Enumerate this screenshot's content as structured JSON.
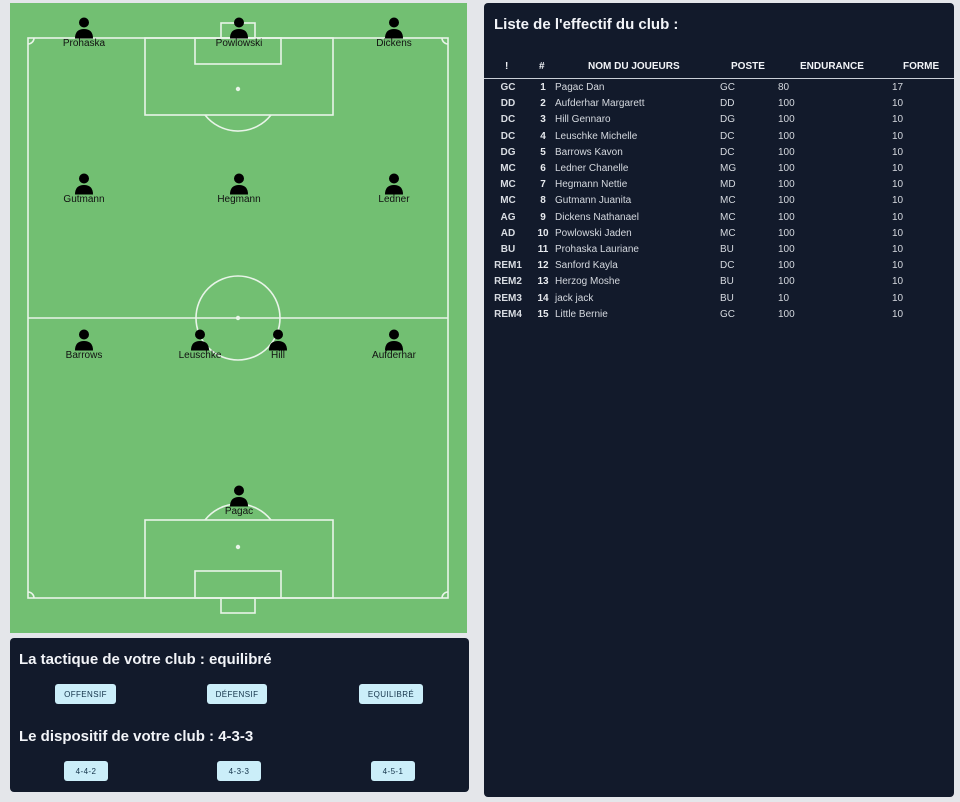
{
  "pitch": {
    "players": [
      {
        "name": "Prohaska",
        "role": "striker-left"
      },
      {
        "name": "Powlowski",
        "role": "striker-center"
      },
      {
        "name": "Dickens",
        "role": "striker-right"
      },
      {
        "name": "Gutmann",
        "role": "midfield-left"
      },
      {
        "name": "Hegmann",
        "role": "midfield-center"
      },
      {
        "name": "Ledner",
        "role": "midfield-right"
      },
      {
        "name": "Barrows",
        "role": "defender-1"
      },
      {
        "name": "Leuschke",
        "role": "defender-2"
      },
      {
        "name": "Hill",
        "role": "defender-3"
      },
      {
        "name": "Aufderhar",
        "role": "defender-4"
      },
      {
        "name": "Pagac",
        "role": "goalkeeper"
      }
    ],
    "player_icon": "person-icon"
  },
  "tactics": {
    "title": "La tactique de votre club : equilibré",
    "buttons": [
      "OFFENSIF",
      "DÉFENSIF",
      "EQUILIBRÉ"
    ],
    "formation_title": "Le dispositif de votre club : 4-3-3",
    "formation_buttons": [
      "4-4-2",
      "4-3-3",
      "4-5-1"
    ]
  },
  "roster": {
    "title": "Liste de l'effectif du club :",
    "columns": [
      "!",
      "#",
      "NOM DU JOUEURS",
      "POSTE",
      "ENDURANCE",
      "FORME"
    ],
    "rows": [
      {
        "pos": "GC",
        "num": "1",
        "name": "Pagac Dan",
        "poste": "GC",
        "endurance": "80",
        "forme": "17"
      },
      {
        "pos": "DD",
        "num": "2",
        "name": "Aufderhar Margarett",
        "poste": "DD",
        "endurance": "100",
        "forme": "10"
      },
      {
        "pos": "DC",
        "num": "3",
        "name": "Hill Gennaro",
        "poste": "DG",
        "endurance": "100",
        "forme": "10"
      },
      {
        "pos": "DC",
        "num": "4",
        "name": "Leuschke Michelle",
        "poste": "DC",
        "endurance": "100",
        "forme": "10"
      },
      {
        "pos": "DG",
        "num": "5",
        "name": "Barrows Kavon",
        "poste": "DC",
        "endurance": "100",
        "forme": "10"
      },
      {
        "pos": "MC",
        "num": "6",
        "name": "Ledner Chanelle",
        "poste": "MG",
        "endurance": "100",
        "forme": "10"
      },
      {
        "pos": "MC",
        "num": "7",
        "name": "Hegmann Nettie",
        "poste": "MD",
        "endurance": "100",
        "forme": "10"
      },
      {
        "pos": "MC",
        "num": "8",
        "name": "Gutmann Juanita",
        "poste": "MC",
        "endurance": "100",
        "forme": "10"
      },
      {
        "pos": "AG",
        "num": "9",
        "name": "Dickens Nathanael",
        "poste": "MC",
        "endurance": "100",
        "forme": "10"
      },
      {
        "pos": "AD",
        "num": "10",
        "name": "Powlowski Jaden",
        "poste": "MC",
        "endurance": "100",
        "forme": "10"
      },
      {
        "pos": "BU",
        "num": "11",
        "name": "Prohaska Lauriane",
        "poste": "BU",
        "endurance": "100",
        "forme": "10"
      },
      {
        "pos": "REM1",
        "num": "12",
        "name": "Sanford Kayla",
        "poste": "DC",
        "endurance": "100",
        "forme": "10"
      },
      {
        "pos": "REM2",
        "num": "13",
        "name": "Herzog Moshe",
        "poste": "BU",
        "endurance": "100",
        "forme": "10"
      },
      {
        "pos": "REM3",
        "num": "14",
        "name": "jack jack",
        "poste": "BU",
        "endurance": "10",
        "forme": "10"
      },
      {
        "pos": "REM4",
        "num": "15",
        "name": "Little Bernie",
        "poste": "GC",
        "endurance": "100",
        "forme": "10"
      }
    ]
  },
  "colors": {
    "pitch": "#72bf72",
    "panel": "#121a2b",
    "button": "#cbeef9",
    "background": "#e4e6ea"
  }
}
